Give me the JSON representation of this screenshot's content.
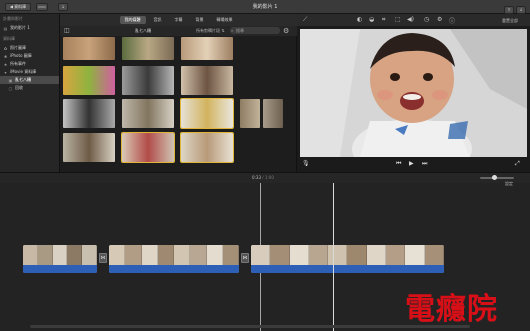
{
  "titlebar": {
    "library_button": "◀ 資料庫",
    "window_title": "我的影片 1",
    "right_buttons": [
      "⇪",
      "↓"
    ]
  },
  "sidebar": {
    "section_projects": "計畫與影片",
    "project_item": "我的影片 1",
    "section_libraries": "資料庫",
    "items": [
      {
        "label": "照片圖庫",
        "icon": "photos-icon"
      },
      {
        "label": "iPhoto 圖庫",
        "icon": "iphoto-icon"
      },
      {
        "label": "所有事件",
        "icon": "star-icon"
      },
      {
        "label": "iMovie 資料庫",
        "icon": "library-icon"
      },
      {
        "label": "亂七八糟",
        "icon": "event-icon",
        "selected": true
      },
      {
        "label": "回收",
        "icon": "trash-icon"
      }
    ]
  },
  "browser": {
    "tabs": [
      "我的媒體",
      "音訊",
      "字幕",
      "背景",
      "轉場效果"
    ],
    "active_tab": 0,
    "album_name": "亂七八糟",
    "filter": "所有剪輯片段 ⇅",
    "search_placeholder": "搜尋"
  },
  "viewer": {
    "reset_label": "重置全部",
    "tools": [
      "◐",
      "◒",
      "⌗",
      "⬚",
      "◀)",
      "◷",
      "⚙",
      "ⓘ"
    ]
  },
  "timeline": {
    "timecode_current": "0:33",
    "timecode_total": "/ 1:00",
    "settings_label": "設定"
  },
  "watermark": "電癮院"
}
